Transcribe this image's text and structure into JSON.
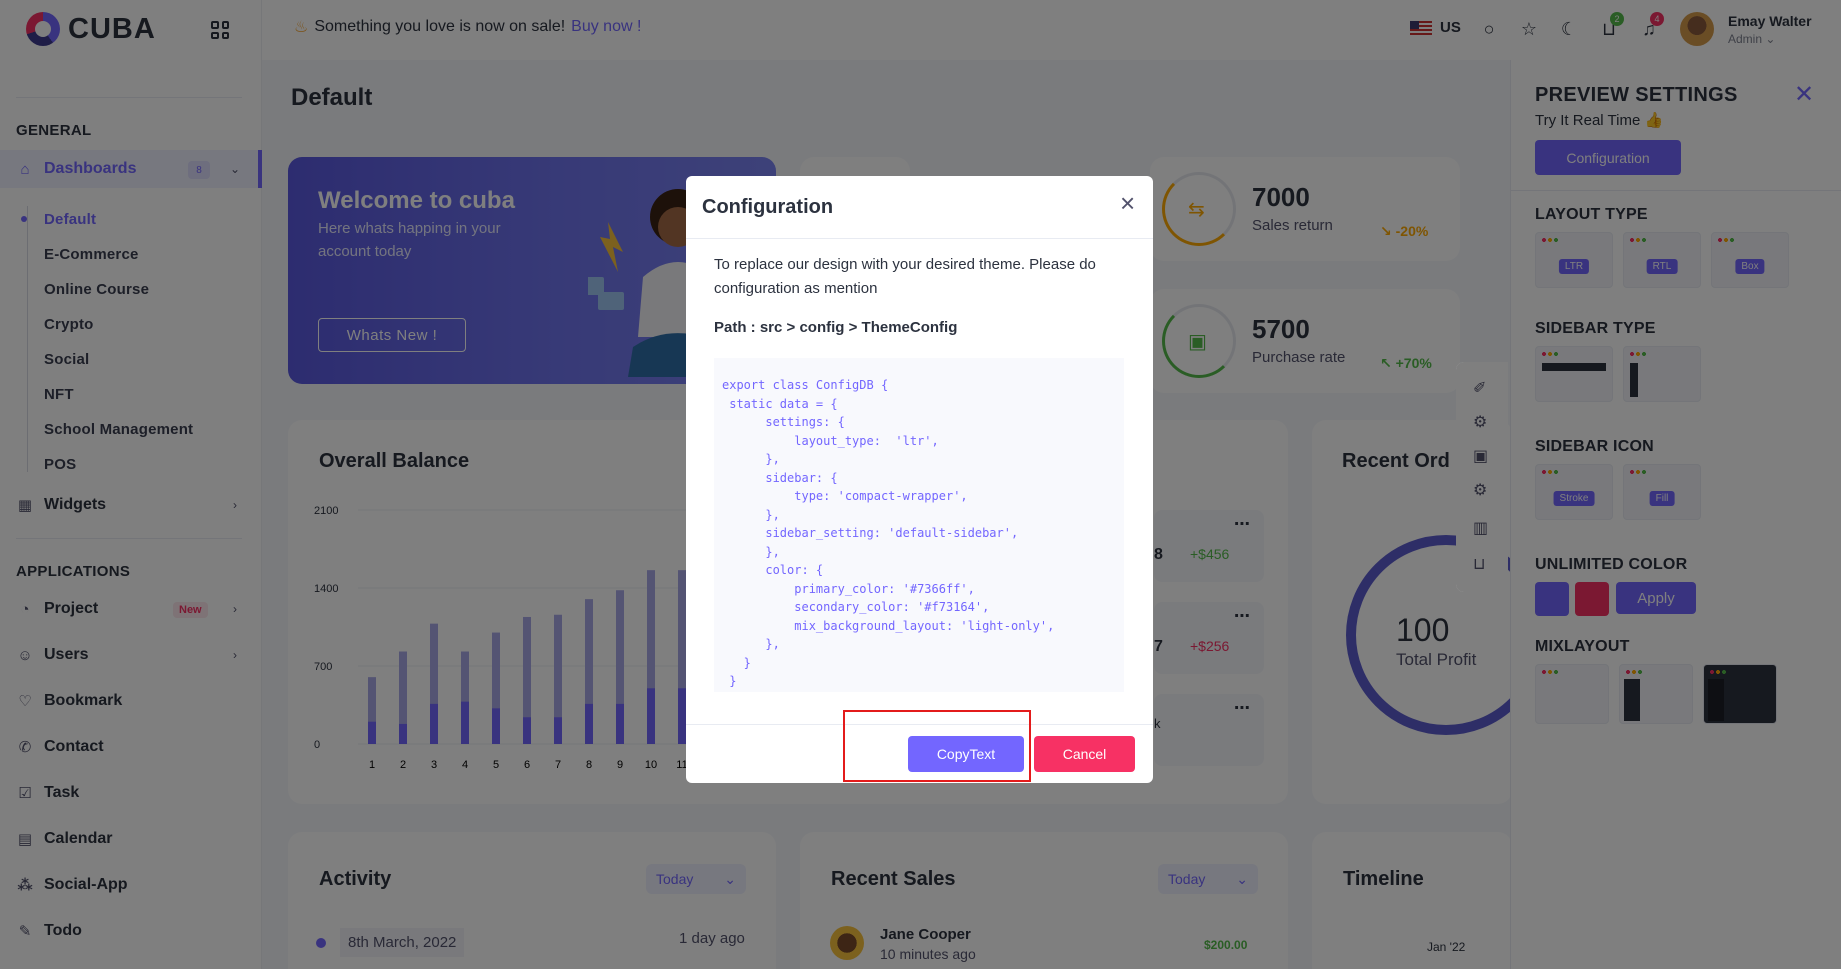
{
  "app": {
    "logo_text": "CUBA"
  },
  "header": {
    "promo_text": "Something you love is now on sale!",
    "promo_link": "Buy now !",
    "language": "US",
    "cart_count": "2",
    "notification_count": "4",
    "user_name": "Emay Walter",
    "user_role": "Admin"
  },
  "sidebar": {
    "general_title": "GENERAL",
    "dashboards_label": "Dashboards",
    "dashboards_badge": "8",
    "dashboard_items": [
      "Default",
      "E-Commerce",
      "Online Course",
      "Crypto",
      "Social",
      "NFT",
      "School Management",
      "POS"
    ],
    "widgets_label": "Widgets",
    "applications_title": "APPLICATIONS",
    "project_label": "Project",
    "project_badge": "New",
    "users_label": "Users",
    "bookmark_label": "Bookmark",
    "contact_label": "Contact",
    "task_label": "Task",
    "calendar_label": "Calendar",
    "social_app_label": "Social-App",
    "todo_label": "Todo"
  },
  "main": {
    "page_title": "Default",
    "welcome_title": "Welcome to cuba",
    "welcome_sub": "Here whats happing in your account today",
    "welcome_button": "Whats New !",
    "stats": [
      {
        "value": "7000",
        "label": "Sales return",
        "change": "-20%",
        "color": "#ffaa05"
      },
      {
        "value": "5700",
        "label": "Purchase rate",
        "change": "+70%",
        "color": "#54ba4a"
      }
    ],
    "balance_title": "Overall Balance",
    "recent_orders_title": "Recent Ord",
    "donut_value": "100",
    "donut_label": "Total Profit",
    "mini_values": [
      "+$456",
      "+$256"
    ],
    "mini_fragments": [
      "8",
      "7",
      "k"
    ],
    "activity_title": "Activity",
    "activity_filter": "Today",
    "activity_date": "8th March, 2022",
    "activity_ago": "1 day ago",
    "recent_sales_title": "Recent Sales",
    "recent_sales_filter": "Today",
    "sale_name": "Jane Cooper",
    "sale_time": "10 minutes ago",
    "sale_amount": "$200.00",
    "timeline_title": "Timeline",
    "timeline_month": "Jan '22"
  },
  "chart_data": {
    "type": "bar",
    "categories": [
      "1",
      "2",
      "3",
      "4",
      "5",
      "6",
      "7",
      "8",
      "9",
      "10",
      "11"
    ],
    "series": [
      {
        "values": [
          600,
          830,
          1080,
          830,
          1000,
          1140,
          1160,
          1300,
          1380,
          1560,
          1560
        ]
      },
      {
        "values": [
          200,
          180,
          360,
          380,
          320,
          240,
          240,
          360,
          360,
          500,
          500
        ]
      }
    ],
    "yticks": [
      "0",
      "700",
      "1400",
      "2100"
    ],
    "ylim": [
      0,
      2100
    ],
    "colors": [
      "#a8a8e6",
      "#7366ff"
    ]
  },
  "settings": {
    "title": "PREVIEW SETTINGS",
    "subtitle": "Try It Real Time",
    "configuration_button": "Configuration",
    "layout_type_title": "LAYOUT TYPE",
    "layout_options": [
      "LTR",
      "RTL",
      "Box"
    ],
    "sidebar_type_title": "SIDEBAR TYPE",
    "sidebar_icon_title": "SIDEBAR ICON",
    "sidebar_icon_options": [
      "Stroke",
      "Fill"
    ],
    "unlimited_color_title": "UNLIMITED COLOR",
    "colors": [
      "#7366ff",
      "#f73164"
    ],
    "apply_button": "Apply",
    "mixlayout_title": "MIXLAYOUT"
  },
  "modal": {
    "title": "Configuration",
    "text": "To replace our design with your desired theme. Please do configuration as mention",
    "path": "Path : src > config > ThemeConfig",
    "code": "export class ConfigDB {\n static data = {\n      settings: {\n          layout_type:  'ltr',\n      },\n      sidebar: {\n          type: 'compact-wrapper',\n      },\n      sidebar_setting: 'default-sidebar',\n      },\n      color: {\n          primary_color: '#7366ff',\n          secondary_color: '#f73164',\n          mix_background_layout: 'light-only',\n      },\n   }\n }",
    "copy_button": "CopyText",
    "cancel_button": "Cancel"
  }
}
